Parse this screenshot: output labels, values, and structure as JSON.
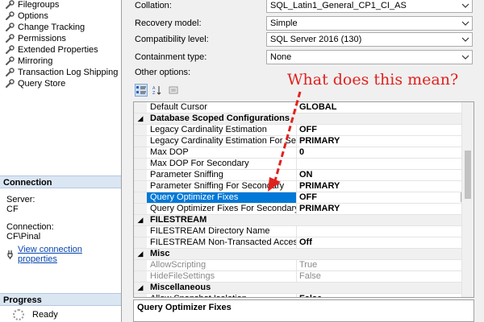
{
  "pages": [
    {
      "label": "Filegroups",
      "icon": "wrench-icon"
    },
    {
      "label": "Options",
      "icon": "wrench-icon"
    },
    {
      "label": "Change Tracking",
      "icon": "wrench-icon"
    },
    {
      "label": "Permissions",
      "icon": "wrench-icon"
    },
    {
      "label": "Extended Properties",
      "icon": "wrench-icon"
    },
    {
      "label": "Mirroring",
      "icon": "wrench-icon"
    },
    {
      "label": "Transaction Log Shipping",
      "icon": "wrench-icon"
    },
    {
      "label": "Query Store",
      "icon": "wrench-icon"
    }
  ],
  "connection": {
    "header": "Connection",
    "server_label": "Server:",
    "server_value": "CF",
    "connection_label": "Connection:",
    "connection_value": "CF\\Pinal",
    "view_link": "View connection properties"
  },
  "progress": {
    "header": "Progress",
    "status": "Ready"
  },
  "options": {
    "collation": {
      "label": "Collation:",
      "value": "SQL_Latin1_General_CP1_CI_AS"
    },
    "recovery_model": {
      "label": "Recovery model:",
      "value": "Simple"
    },
    "compatibility_level": {
      "label": "Compatibility level:",
      "value": "SQL Server 2016 (130)"
    },
    "containment_type": {
      "label": "Containment type:",
      "value": "None"
    },
    "other_options_label": "Other options:"
  },
  "grid": {
    "rows": [
      {
        "kind": "prop",
        "name": "Default Cursor",
        "value": "GLOBAL"
      },
      {
        "kind": "cat",
        "name": "Database Scoped Configurations"
      },
      {
        "kind": "prop",
        "name": "Legacy Cardinality Estimation",
        "value": "OFF"
      },
      {
        "kind": "prop",
        "name": "Legacy Cardinality Estimation For Secondary",
        "value": "PRIMARY"
      },
      {
        "kind": "prop",
        "name": "Max DOP",
        "value": "0"
      },
      {
        "kind": "prop",
        "name": "Max DOP For Secondary",
        "value": ""
      },
      {
        "kind": "prop",
        "name": "Parameter Sniffing",
        "value": "ON"
      },
      {
        "kind": "prop",
        "name": "Parameter Sniffing For Secondary",
        "value": "PRIMARY"
      },
      {
        "kind": "prop",
        "name": "Query Optimizer Fixes",
        "value": "OFF",
        "selected": true
      },
      {
        "kind": "prop",
        "name": "Query Optimizer Fixes For Secondary",
        "value": "PRIMARY"
      },
      {
        "kind": "cat",
        "name": "FILESTREAM"
      },
      {
        "kind": "prop",
        "name": "FILESTREAM Directory Name",
        "value": ""
      },
      {
        "kind": "prop",
        "name": "FILESTREAM Non-Transacted Access",
        "value": "Off"
      },
      {
        "kind": "cat",
        "name": "Misc"
      },
      {
        "kind": "prop",
        "name": "AllowScripting",
        "value": "True",
        "dim": true
      },
      {
        "kind": "prop",
        "name": "HideFileSettings",
        "value": "False",
        "dim": true
      },
      {
        "kind": "cat",
        "name": "Miscellaneous"
      },
      {
        "kind": "prop",
        "name": "Allow Snapshot Isolation",
        "value": "False"
      }
    ],
    "description_title": "Query Optimizer Fixes"
  },
  "annotation": {
    "text": "What does this mean?",
    "color": "#e0221f"
  },
  "colors": {
    "selection": "#0078d7",
    "link": "#0645ad",
    "section_header": "#dbe6f3"
  }
}
